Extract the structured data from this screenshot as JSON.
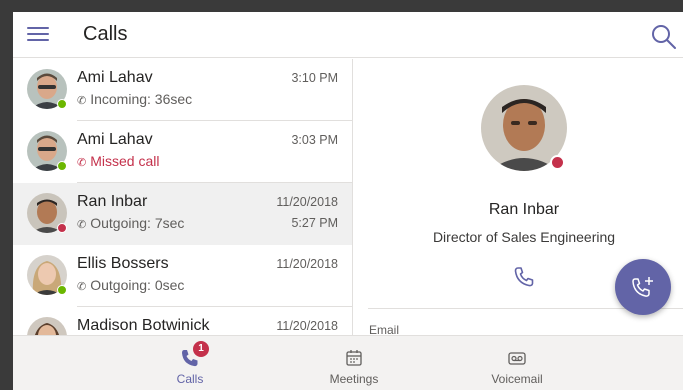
{
  "header": {
    "title": "Calls"
  },
  "calls": [
    {
      "name": "Ami Lahav",
      "status": "Incoming: 36sec",
      "status_icon": "incoming-call-icon",
      "time": "3:10 PM",
      "time2": "",
      "presence": "available",
      "missed": false
    },
    {
      "name": "Ami Lahav",
      "status": "Missed call",
      "status_icon": "missed-call-icon",
      "time": "3:03 PM",
      "time2": "",
      "presence": "available",
      "missed": true
    },
    {
      "name": "Ran Inbar",
      "status": "Outgoing: 7sec",
      "status_icon": "outgoing-call-icon",
      "time": "11/20/2018",
      "time2": "5:27 PM",
      "presence": "busy",
      "missed": false
    },
    {
      "name": "Ellis Bossers",
      "status": "Outgoing: 0sec",
      "status_icon": "outgoing-call-icon",
      "time": "11/20/2018",
      "time2": "",
      "presence": "available",
      "missed": false
    },
    {
      "name": "Madison Botwinick",
      "status": "",
      "status_icon": "",
      "time": "11/20/2018",
      "time2": "",
      "presence": "",
      "missed": false
    }
  ],
  "detail": {
    "name": "Ran Inbar",
    "title": "Director of Sales Engineering",
    "email_label": "Email",
    "presence": "busy"
  },
  "bottom_nav": {
    "calls": {
      "label": "Calls",
      "badge": "1"
    },
    "meetings": {
      "label": "Meetings"
    },
    "voicemail": {
      "label": "Voicemail"
    }
  },
  "colors": {
    "brand": "#6264a7",
    "busy": "#c4314b",
    "available": "#6bb700"
  }
}
